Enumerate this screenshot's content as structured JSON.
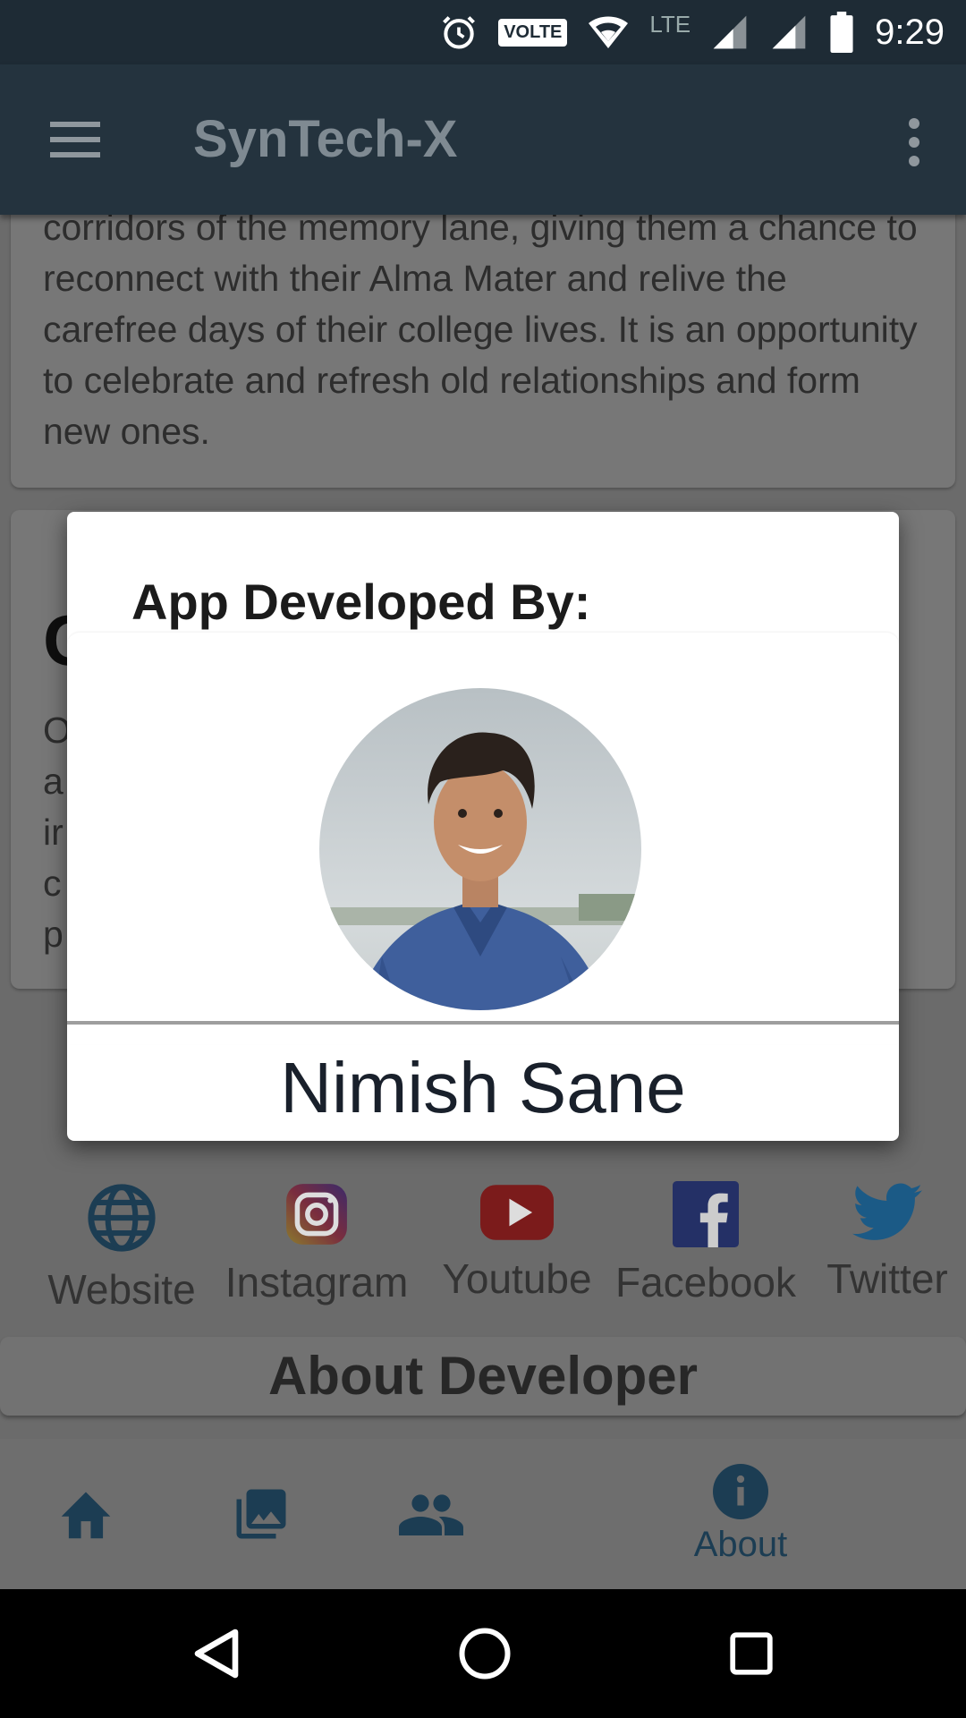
{
  "status_bar": {
    "time": "9:29",
    "volte": "VOLTE",
    "network": "LTE"
  },
  "app_bar": {
    "title": "SynTech-X"
  },
  "card1": {
    "text": "corridors of the memory lane, giving them a chance to reconnect with their Alma Mater and relive the carefree days of their college lives. It is an opportunity to celebrate and refresh old relationships and form new ones."
  },
  "card2": {
    "heading_initial": "C",
    "line_initials": [
      "O",
      "a",
      "ir",
      "c",
      "p"
    ]
  },
  "socials": [
    {
      "label": "Website",
      "icon": "globe-icon"
    },
    {
      "label": "Instagram",
      "icon": "instagram-icon"
    },
    {
      "label": "Youtube",
      "icon": "youtube-icon"
    },
    {
      "label": "Facebook",
      "icon": "facebook-icon"
    },
    {
      "label": "Twitter",
      "icon": "twitter-icon"
    }
  ],
  "about_developer": "About Developer",
  "bottom_nav": [
    {
      "icon": "home-icon",
      "label": ""
    },
    {
      "icon": "gallery-icon",
      "label": ""
    },
    {
      "icon": "people-icon",
      "label": ""
    },
    {
      "icon": "info-icon",
      "label": "About"
    }
  ],
  "dialog": {
    "title": "App Developed By:",
    "name": "Nimish Sane"
  },
  "colors": {
    "dialog_bg": "#ffffff",
    "app_bar": "#24333e",
    "nav_active": "#1c3d53"
  }
}
